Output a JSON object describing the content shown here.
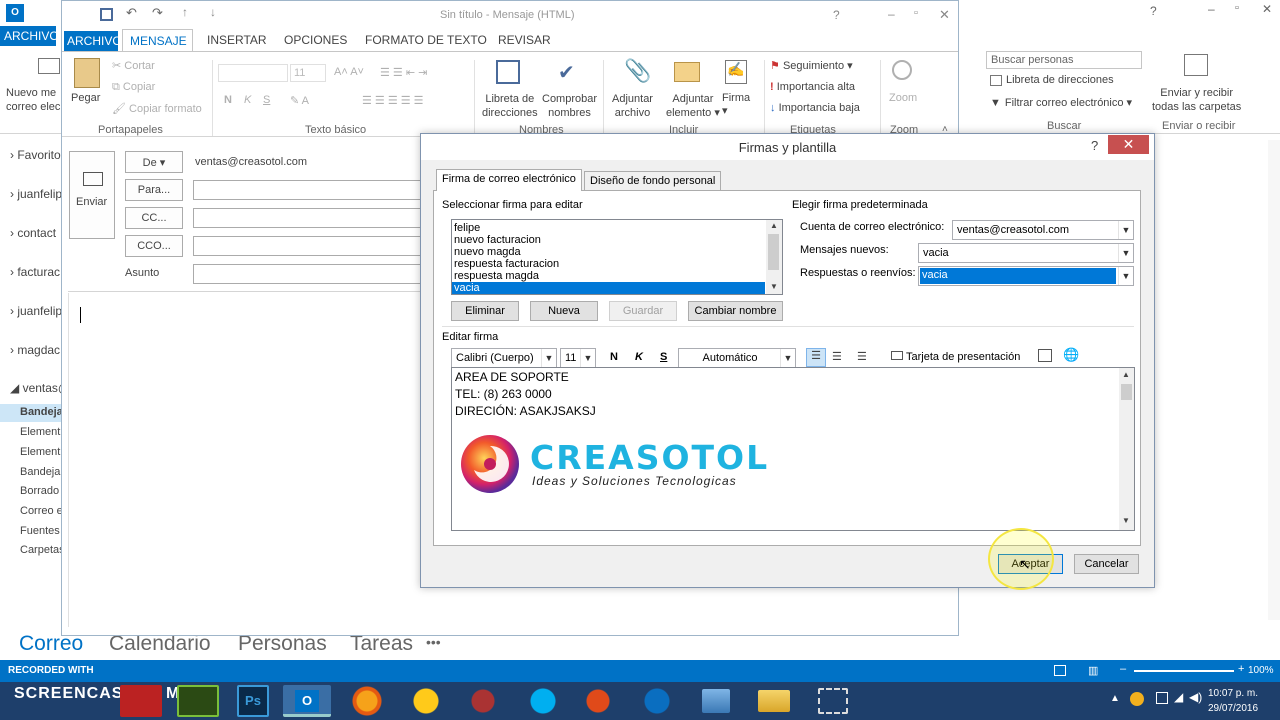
{
  "outlook": {
    "app_icon": "outlook-icon",
    "archivo_tab": "ARCHIVO",
    "new_mail_label": "Nuevo mensaje de correo electrónico",
    "new_mail_short": "Nuevo me",
    "new_mail_short2": "correo elec",
    "search_people_placeholder": "Buscar personas",
    "address_book": "Libreta de direcciones",
    "filter_email": "Filtrar correo electrónico",
    "group_buscar": "Buscar",
    "send_receive": "Enviar y recibir",
    "send_receive2": "todas las carpetas",
    "group_send_receive": "Enviar o recibir",
    "folders": [
      "Favorito",
      "juanfelip",
      "contact",
      "facturac",
      "juanfelip",
      "magdac"
    ],
    "account": "ventas@",
    "subfolders": [
      "Bandeja",
      "Element",
      "Element",
      "Bandeja",
      "Borrado",
      "Correo e",
      "Fuentes",
      "Carpetas"
    ],
    "nav": [
      "Correo",
      "Calendario",
      "Personas",
      "Tareas",
      "•••"
    ],
    "zoom": "100%"
  },
  "message": {
    "title": "Sin título - Mensaje (HTML)",
    "tabs": [
      "ARCHIVO",
      "MENSAJE",
      "INSERTAR",
      "OPCIONES",
      "FORMATO DE TEXTO",
      "REVISAR"
    ],
    "ribbon": {
      "paste": "Pegar",
      "cut": "Cortar",
      "copy": "Copiar",
      "copy_format": "Copiar formato",
      "group_clipboard": "Portapapeles",
      "font_size": "11",
      "group_basic_text": "Texto básico",
      "address_book": "Libreta de direcciones",
      "address_book_1": "Libreta de",
      "address_book_2": "direcciones",
      "check_names_1": "Comprobar",
      "check_names_2": "nombres",
      "group_names": "Nombres",
      "attach_file_1": "Adjuntar",
      "attach_file_2": "archivo",
      "attach_item_1": "Adjuntar",
      "attach_item_2": "elemento",
      "signature": "Firma",
      "group_include": "Incluir",
      "follow_up": "Seguimiento",
      "high_importance": "Importancia alta",
      "low_importance": "Importancia baja",
      "group_tags": "Etiquetas",
      "zoom": "Zoom",
      "group_zoom": "Zoom"
    },
    "send": "Enviar",
    "from_btn": "De",
    "from_value": "ventas@creasotol.com",
    "to_btn": "Para...",
    "cc_btn": "CC...",
    "bcc_btn": "CCO...",
    "subject_label": "Asunto"
  },
  "dialog": {
    "title": "Firmas y plantilla",
    "help": "?",
    "close": "✕",
    "tab_signature": "Firma de correo electrónico",
    "tab_stationery": "Diseño de fondo personal",
    "select_sig_label": "Seleccionar firma para editar",
    "signatures": [
      "felipe",
      "nuevo facturacion",
      "nuevo magda",
      "respuesta facturacion",
      "respuesta magda",
      "vacia"
    ],
    "btn_delete": "Eliminar",
    "btn_new": "Nueva",
    "btn_save": "Guardar",
    "btn_rename": "Cambiar nombre",
    "default_sig_label": "Elegir firma predeterminada",
    "email_account_label": "Cuenta de correo electrónico:",
    "email_account_value": "ventas@creasotol.com",
    "new_messages_label": "Mensajes nuevos:",
    "new_messages_value": "vacia",
    "replies_label": "Respuestas o reenvíos:",
    "replies_value": "vacia",
    "edit_sig_label": "Editar firma",
    "font": "Calibri (Cuerpo)",
    "size": "11",
    "bold": "N",
    "italic": "K",
    "underline": "S",
    "color": "Automático",
    "business_card": "Tarjeta de presentación",
    "sig_lines": [
      "AREA DE SOPORTE",
      "TEL: (8) 263 0000",
      "DIRECIÓN: ASAKJSAKSJ"
    ],
    "logo_name": "CREASOTOL",
    "logo_tagline": "Ideas y Soluciones Tecnologicas",
    "btn_accept": "Aceptar",
    "btn_cancel": "Cancelar"
  },
  "status": {
    "recorded_with": "RECORDED WITH",
    "screencast": "SCREENCAST",
    "matic": "MATIC"
  },
  "taskbar": {
    "time": "10:07 p. m.",
    "date": "29/07/2016"
  },
  "colors": {
    "accent": "#0072c6",
    "selection": "#0078d7",
    "close_red": "#c75050",
    "logo_blue": "#1fb3e0"
  }
}
